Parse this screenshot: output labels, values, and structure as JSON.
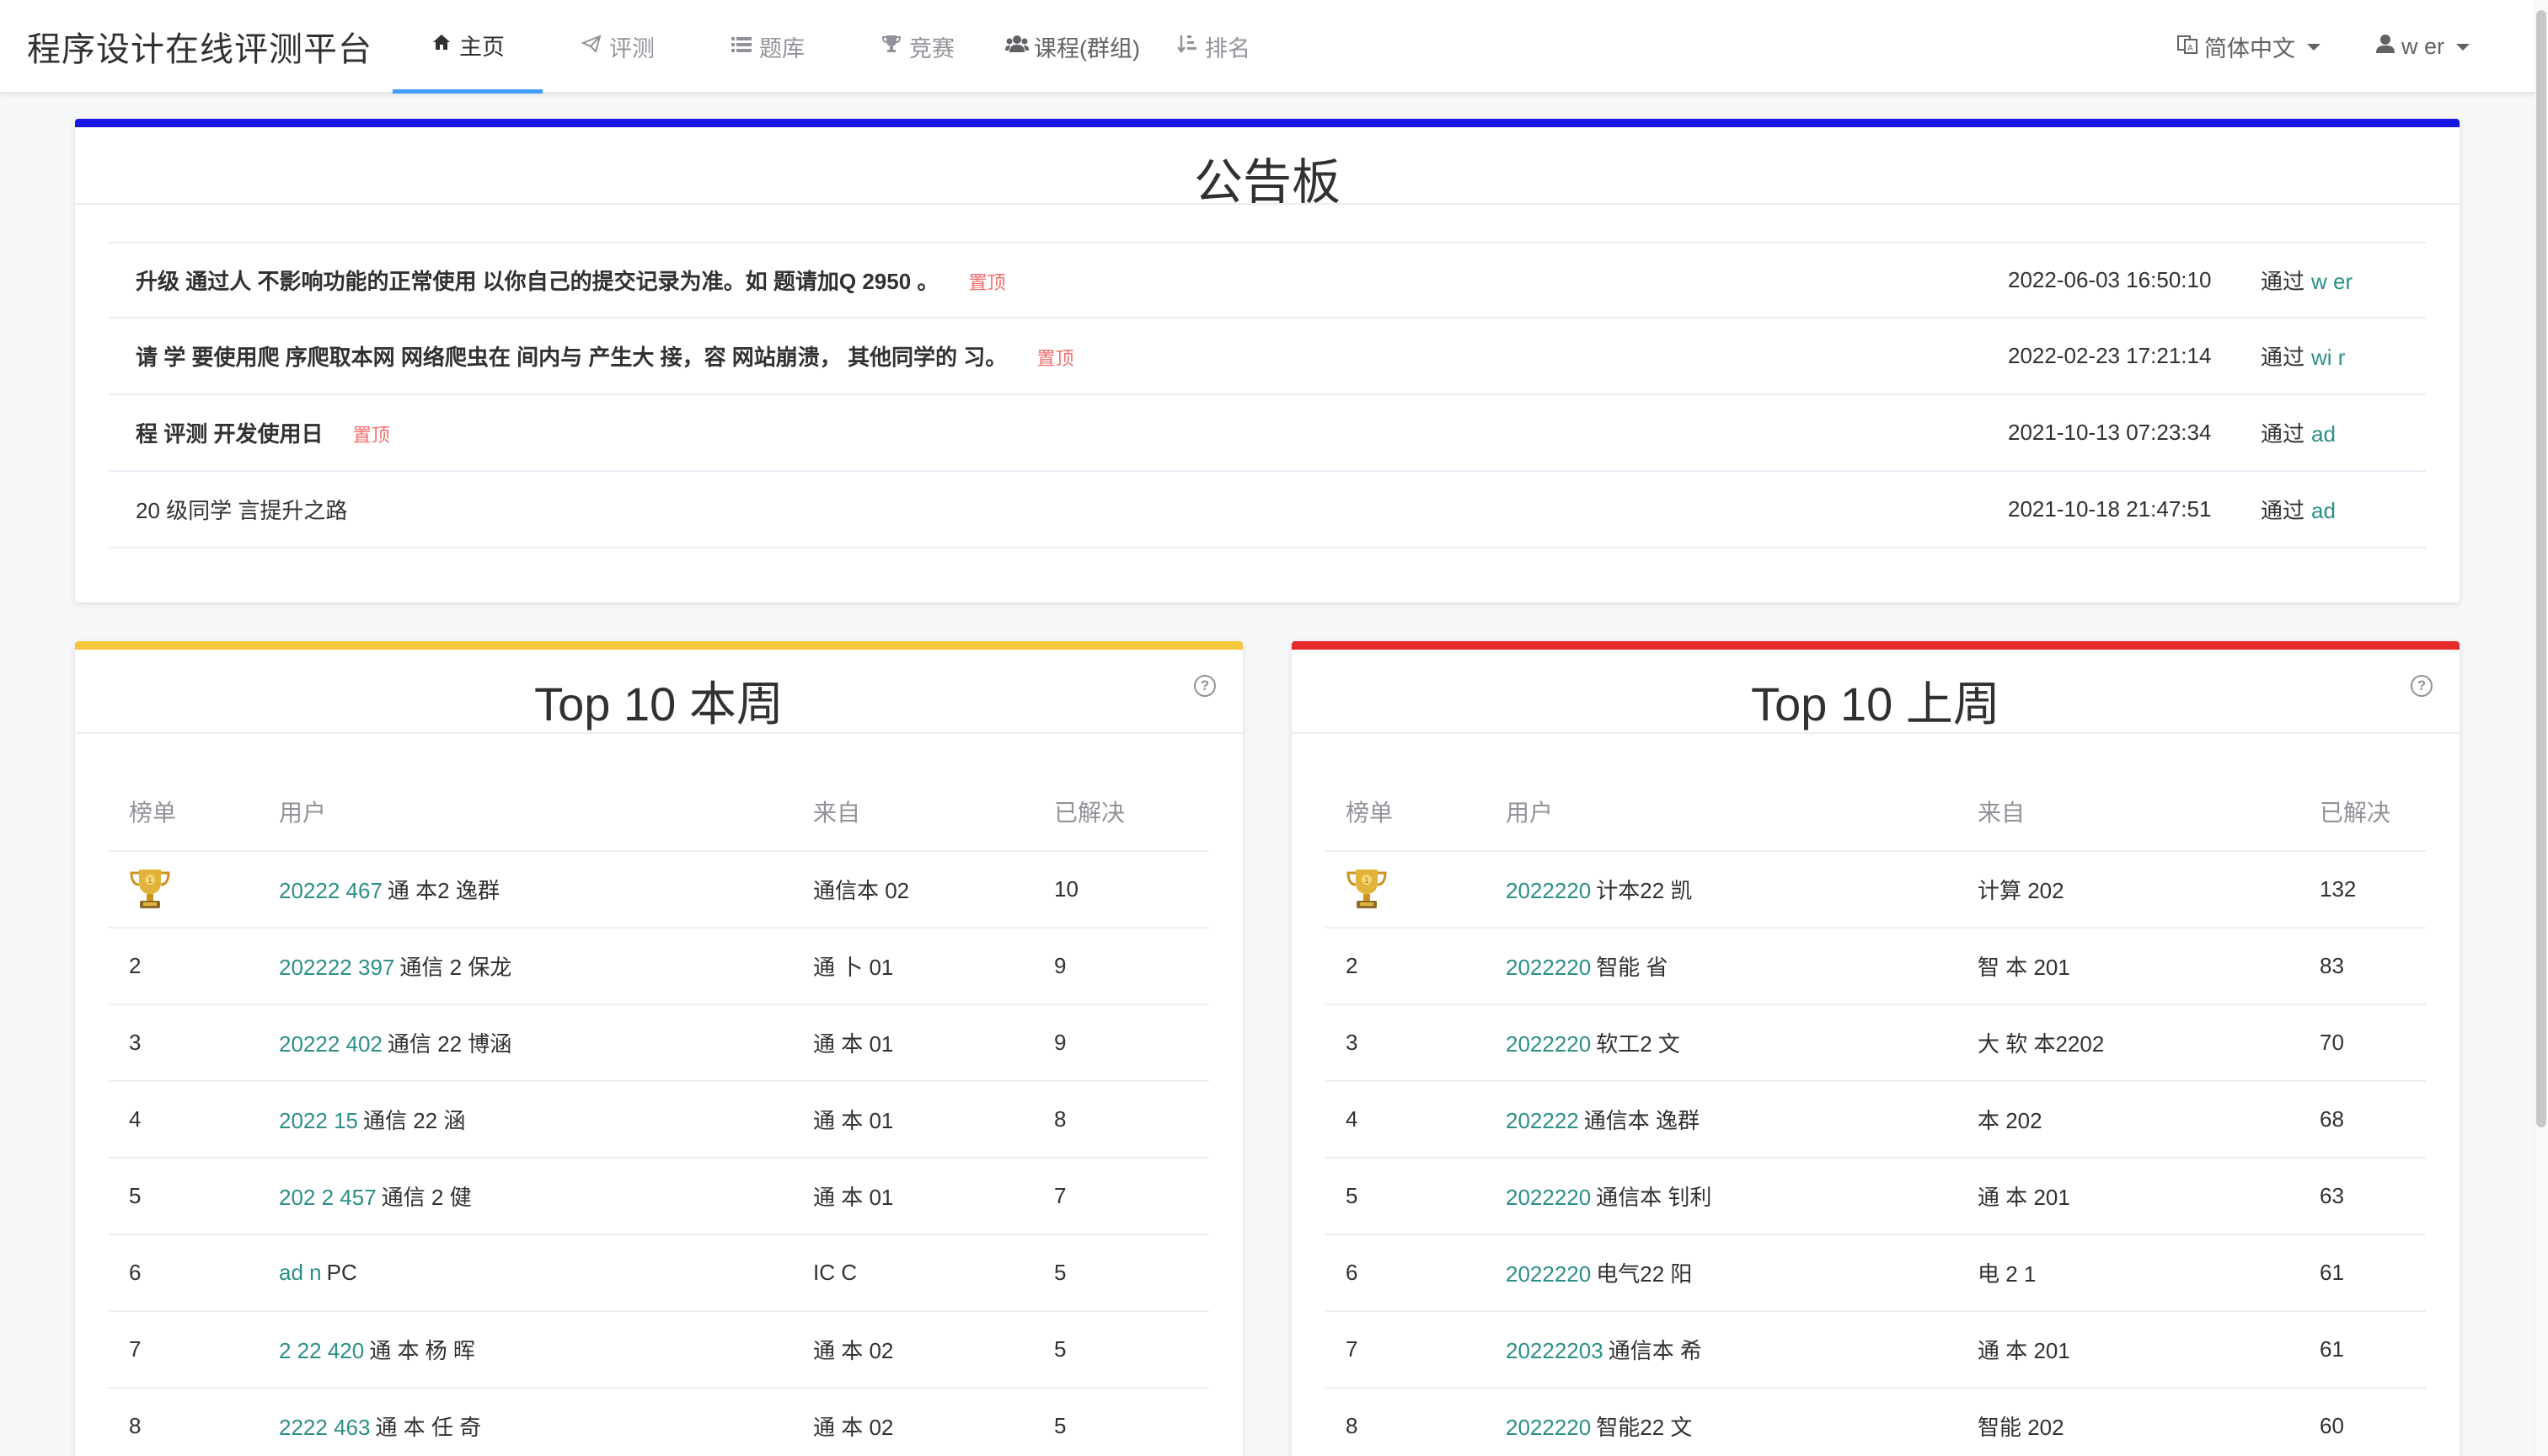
{
  "navbar": {
    "brand": "程序设计在线评测平台",
    "menu": [
      {
        "label": "主页",
        "icon": "home-icon",
        "active": true
      },
      {
        "label": "评测",
        "icon": "paper-plane-icon",
        "active": false
      },
      {
        "label": "题库",
        "icon": "list-icon",
        "active": false
      },
      {
        "label": "竞赛",
        "icon": "trophy-icon",
        "active": false
      },
      {
        "label": "课程(群组)",
        "icon": "users-icon",
        "active": false
      },
      {
        "label": "排名",
        "icon": "sort-icon",
        "active": false
      }
    ],
    "language": "简体中文",
    "username": "w   er"
  },
  "colors": {
    "accent": "#409eff",
    "link": "#2c8f88",
    "pin": "#f56c6c",
    "announce_bar": "#1717e6",
    "week_bar": "#f5c73b",
    "last_week_bar": "#e42a2a"
  },
  "announcements": {
    "title": "公告板",
    "pin_label": "置顶",
    "by_prefix": "通过",
    "items": [
      {
        "title": "升级  通过人      不影响功能的正常使用  以你自己的提交记录为准。如   题请加Q   2950    。",
        "pinned": true,
        "bold": true,
        "time": "2022-06-03 16:50:10",
        "author": "w   er"
      },
      {
        "title": "请 学 要使用爬  序爬取本网  网络爬虫在  间内与   产生大  接，容   网站崩溃，  其他同学的   习。",
        "pinned": true,
        "bold": true,
        "time": "2022-02-23 17:21:14",
        "author": "wi   r"
      },
      {
        "title": "程  评测  开发使用日",
        "pinned": true,
        "bold": true,
        "time": "2021-10-13 07:23:34",
        "author": "ad    "
      },
      {
        "title": "20  级同学  言提升之路",
        "pinned": false,
        "bold": false,
        "time": "2021-10-18 21:47:51",
        "author": "ad    "
      }
    ]
  },
  "top_this_week": {
    "title": "Top 10 本周",
    "headers": {
      "rank": "榜单",
      "user": "用户",
      "from": "来自",
      "solved": "已解决"
    },
    "rows": [
      {
        "rank": "1",
        "trophy": true,
        "uid": "20222  467",
        "name": "通  本2   逸群",
        "from": "通信本  02",
        "solved": "10"
      },
      {
        "rank": "2",
        "trophy": false,
        "uid": "202222  397",
        "name": "通信 2  保龙",
        "from": "通  卜  01",
        "solved": "9"
      },
      {
        "rank": "3",
        "trophy": false,
        "uid": "20222 402",
        "name": "通信  22  博涵",
        "from": "通   本  01",
        "solved": "9"
      },
      {
        "rank": "4",
        "trophy": false,
        "uid": "2022  15",
        "name": "通信  22  涵",
        "from": "通  本  01",
        "solved": "8"
      },
      {
        "rank": "5",
        "trophy": false,
        "uid": "202  2  457",
        "name": "通信  2   健",
        "from": "通  本  01",
        "solved": "7"
      },
      {
        "rank": "6",
        "trophy": false,
        "uid": "ad  n",
        "name": "PC",
        "from": "IC  C",
        "solved": "5"
      },
      {
        "rank": "7",
        "trophy": false,
        "uid": "2  22  420",
        "name": "通  本  杨   晖",
        "from": "通  本  02",
        "solved": "5"
      },
      {
        "rank": "8",
        "trophy": false,
        "uid": "2222  463",
        "name": "通  本   任  奇",
        "from": "通  本  02",
        "solved": "5"
      }
    ]
  },
  "top_last_week": {
    "title": "Top 10 上周",
    "headers": {
      "rank": "榜单",
      "user": "用户",
      "from": "来自",
      "solved": "已解决"
    },
    "rows": [
      {
        "rank": "1",
        "trophy": true,
        "uid": "2022220",
        "name": "计本22   凯",
        "from": "计算  202",
        "solved": "132"
      },
      {
        "rank": "2",
        "trophy": false,
        "uid": "2022220",
        "name": "智能   省",
        "from": "智  本  201",
        "solved": "83"
      },
      {
        "rank": "3",
        "trophy": false,
        "uid": "2022220",
        "name": "软工2   文",
        "from": "大  软   本2202",
        "solved": "70"
      },
      {
        "rank": "4",
        "trophy": false,
        "uid": "202222",
        "name": "通信本   逸群",
        "from": "本  202",
        "solved": "68"
      },
      {
        "rank": "5",
        "trophy": false,
        "uid": "2022220",
        "name": "通信本   钊利",
        "from": "通  本  201",
        "solved": "63"
      },
      {
        "rank": "6",
        "trophy": false,
        "uid": "2022220",
        "name": "电气22   阳",
        "from": "电  2  1",
        "solved": "61"
      },
      {
        "rank": "7",
        "trophy": false,
        "uid": "20222203",
        "name": "通信本   希",
        "from": "通  本  201",
        "solved": "61"
      },
      {
        "rank": "8",
        "trophy": false,
        "uid": "2022220",
        "name": "智能22   文",
        "from": "智能  202",
        "solved": "60"
      }
    ]
  }
}
